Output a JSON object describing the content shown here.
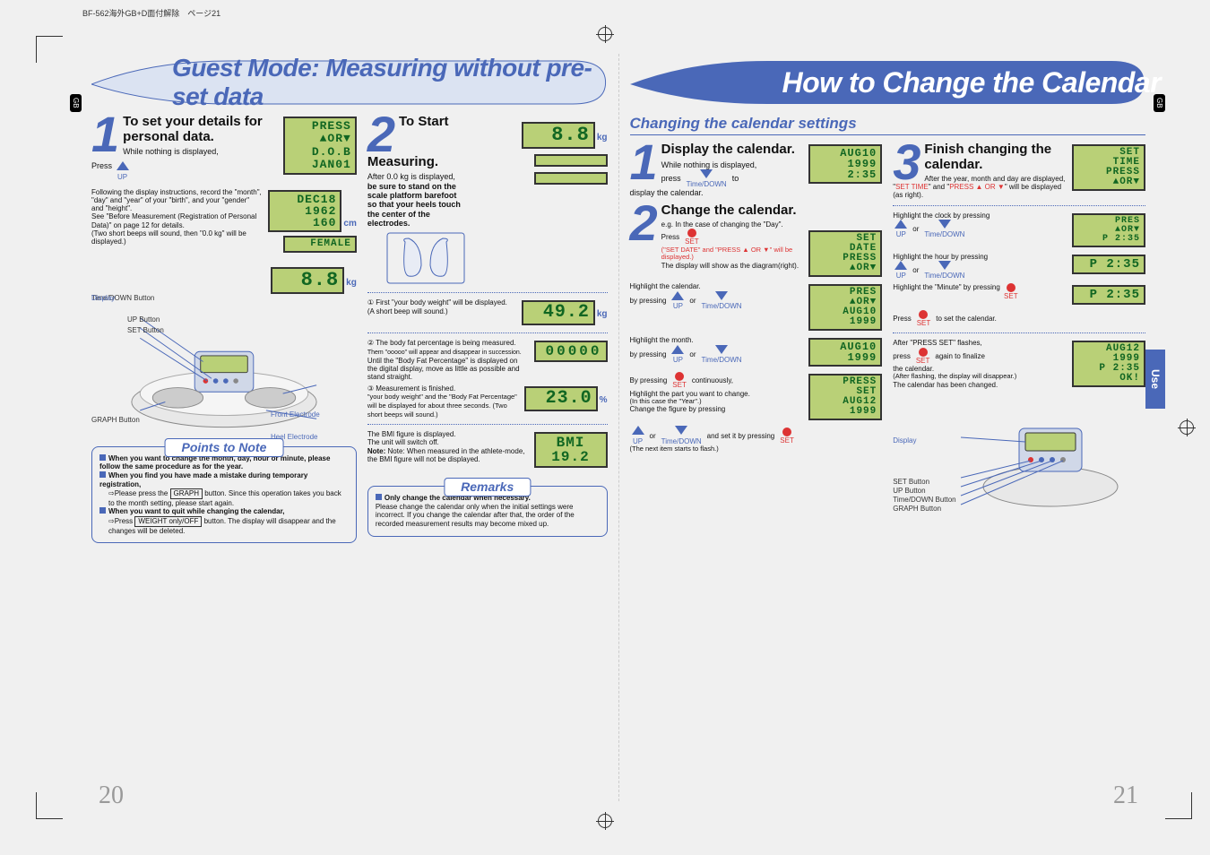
{
  "header_file": "BF-562海外GB+D面付解除　ページ21",
  "gb": "GB",
  "use": "Use",
  "page_left_num": "20",
  "page_right_num": "21",
  "left": {
    "banner": "Guest Mode: Measuring without pre-set data",
    "step1": {
      "num": "1",
      "title": "To set your details for personal data.",
      "nothing": "While nothing is displayed,",
      "press": "Press",
      "up": "UP",
      "follow": "Following the display instructions, record the \"month\", \"day\" and \"year\" of your \"birth\", and your \"gender\" and \"height\".",
      "see": "See \"Before Measurement (Registration of Personal Data)\" on page 12 for details.",
      "beeps": "(Two short beeps will sound, then \"0.0 kg\" will be displayed.)",
      "lcd1": "PRESS\n▲OR▼\nD.O.B\nJAN01",
      "lcd2": "DEC18\n1962\n160",
      "lcd2b": "FEMALE",
      "cm": "cm",
      "lcd3": "8.8",
      "kg": "kg",
      "labels": {
        "time": "Time/DOWN Button",
        "display": "Display",
        "up": "UP Button",
        "set": "SET Button",
        "graph": "GRAPH Button",
        "front": "Front Electrode",
        "heel": "Heel Electrode"
      }
    },
    "step2": {
      "num": "2",
      "title": "To Start Measuring.",
      "after": "After 0.0 kg is displayed,",
      "stand": "be sure to stand on the scale platform barefoot so that your heels touch the center of the electrodes.",
      "lcd1": "8.8",
      "kg": "kg",
      "c1": "① First \"your body weight\" will be displayed.",
      "c1s": "(A short beep will sound.)",
      "lcd2": "49.2",
      "c2": "② The body fat percentage is being measured.",
      "c2a": "Them \"ooooo\" will appear and disappear in succession.",
      "c2b": "Until the \"Body Fat Percentage\" is displayed on the digital display, move as little as possible and stand straight.",
      "lcd3": "00000",
      "c3": "③ Measurement is finished.",
      "c3a": "\"your body weight\" and the \"Body Fat Percentage\" will be displayed for about three seconds. (Two short beeps will sound.)",
      "lcd4": "23.0",
      "pct": "%",
      "bmi1": "The BMI figure is displayed.",
      "bmi2": "The unit will switch off.",
      "bmi3": "Note: When measured in the athlete-mode, the BMI figure will not be displayed.",
      "lcd5": "BMI\n19.2"
    },
    "points": {
      "title": "Points to Note",
      "l1": "When you want to change the month, day, hour or minute, please follow the same procedure as for the year.",
      "l2": "When you find you have made a mistake during temporary registration,",
      "l2a": "⇨Please press the",
      "graph": "GRAPH",
      "l2b": "button. Since this operation takes you back to the month setting, please start again.",
      "l3": "When you want to quit while changing the calendar,",
      "l3a": "⇨Press",
      "weight": "WEIGHT only/OFF",
      "l3b": "button. The display will disappear and the changes will be deleted."
    },
    "remarks": {
      "title": "Remarks",
      "l1": "Only change the calendar when necessary.",
      "l2": "Please change the calendar only when the initial settings were incorrect. If you change the calendar after that, the order of the recorded measurement results may become mixed up."
    }
  },
  "right": {
    "banner": "How to Change the Calendar",
    "section": "Changing the calendar settings",
    "step1": {
      "num": "1",
      "title": "Display the calendar.",
      "nothing": "While nothing is displayed,",
      "press": "press",
      "time": "Time/DOWN",
      "to": "to",
      "disp": "display the calendar.",
      "lcd": "AUG10\n1999\n2:35"
    },
    "step2": {
      "num": "2",
      "title": "Change the calendar.",
      "eg": "e.g. In the case of changing the \"Day\".",
      "press": "Press",
      "set": "SET",
      "setdate": "(\"SET DATE\" and \"PRESS ▲ OR ▼\" will be displayed.)",
      "show": "The display will show as the diagram(right).",
      "lcd1": "SET\nDATE\nPRESS\n▲OR▼",
      "hcal": "Highlight the calendar.",
      "byp": "by pressing",
      "up": "UP",
      "or": "or",
      "time": "Time/DOWN",
      "lcd2": "PRES\n▲OR▼\nAUG10\n1999",
      "hmon": "Highlight the month.",
      "lcd3": "AUG10\n1999",
      "bypset": "By pressing",
      "cont": "continuously,",
      "lcd4": "PRESS\nSET\nAUG12\n1999",
      "hpart": "Highlight the part you want to change.",
      "incase": "(In this case the \"Year\".)",
      "chfig": "Change the figure by pressing",
      "andset": "and set it by pressing",
      "nextflash": "(The next item starts to flash.)"
    },
    "step3": {
      "num": "3",
      "title": "Finish changing the calendar.",
      "after": "After the year, month and day are displayed, \"",
      "settime": "SET TIME",
      "and": "\" and \"",
      "pressor": "PRESS ▲ OR ▼",
      "willbe": "\" will be displayed (as right).",
      "lcd1": "SET\nTIME\nPRESS\n▲OR▼",
      "hclock": "Highlight the clock by pressing",
      "lcd2": "PRES\n▲OR▼\nP 2:35",
      "hhour": "Highlight the hour by pressing",
      "lcd3": "P 2:35",
      "hmin": "Highlight the \"Minute\" by pressing",
      "lcd4": "P 2:35",
      "pressset": "Press",
      "tosetcal": "to set the calendar.",
      "afterflash": "After \"PRESS SET\" flashes,",
      "pressagain": "press",
      "again": "again to finalize",
      "thecal": "the calendar.",
      "afterfl": "(After flashing, the display will disappear.)",
      "changed": "The calendar has been changed.",
      "lcd5": "AUG12\n1999\nP 2:35\nOK!",
      "labels": {
        "display": "Display",
        "set": "SET Button",
        "up": "UP Button",
        "time": "Time/DOWN Button",
        "graph": "GRAPH Button"
      }
    }
  }
}
